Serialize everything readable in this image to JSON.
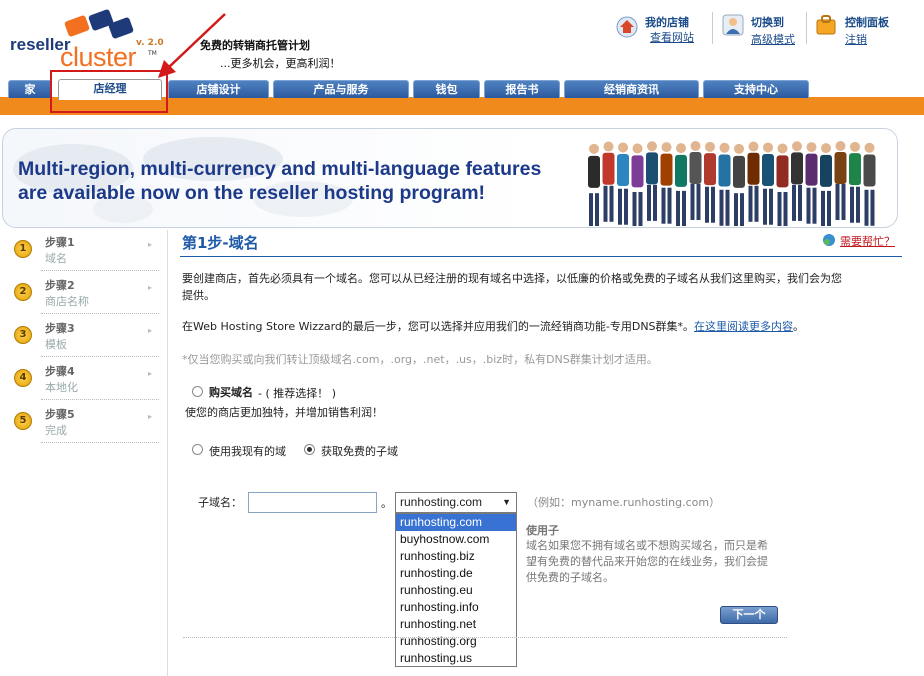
{
  "logo": {
    "reseller": "reseller",
    "cluster": "cluster",
    "version": "v. 2.0",
    "tm": "TM"
  },
  "tagline": {
    "line1": "免费的转销商托管计划",
    "line2": "...更多机会，更高利润！"
  },
  "top_links": {
    "store": {
      "title": "我的店铺",
      "link": "查看网站"
    },
    "switch": {
      "title": "切换到",
      "link": "高级模式"
    },
    "panel": {
      "title": "控制面板",
      "link": "注销"
    }
  },
  "nav": {
    "tabs": [
      {
        "label": "家"
      },
      {
        "label": "店经理"
      },
      {
        "label": "店铺设计"
      },
      {
        "label": "产品与服务"
      },
      {
        "label": "钱包"
      },
      {
        "label": "报告书"
      },
      {
        "label": "经销商资讯"
      },
      {
        "label": "支持中心"
      }
    ]
  },
  "banner": {
    "line1": "Multi-region, multi-currency and multi-language features",
    "line2": "are available now on the reseller hosting program!"
  },
  "steps": [
    {
      "num": "1",
      "title": "步骤1",
      "sub": "域名"
    },
    {
      "num": "2",
      "title": "步骤2",
      "sub": "商店名称"
    },
    {
      "num": "3",
      "title": "步骤3",
      "sub": "模板"
    },
    {
      "num": "4",
      "title": "步骤4",
      "sub": "本地化"
    },
    {
      "num": "5",
      "title": "步骤5",
      "sub": "完成"
    }
  ],
  "main": {
    "heading": "第1步-域名",
    "help": "需要帮忙？",
    "para1_line1": "要创建商店，首先必须具有一个域名。您可以从已经注册的现有域名中选择，以低廉的价格或免费的子域名从我们这里购买，我们会为您",
    "para1_line2": "提供。",
    "para2_text": "在Web Hosting Store Wizzard的最后一步，您可以选择并应用我们的一流经销商功能-专用DNS群集*。",
    "para2_link": "在这里阅读更多内容",
    "para2_end": "。",
    "note": "*仅当您购买或向我们转让顶级域名.com，.org，.net，.us，.biz时，私有DNS群集计划才适用。",
    "opt_buy": "购买域名",
    "opt_buy_rec": " - ( 推荐选择！ )",
    "opt_buy_desc": "使您的商店更加独特，并增加销售利润！",
    "opt_existing": "使用我现有的域",
    "opt_free": "获取免费的子域",
    "subdomain_label": "子域名：",
    "subdomain_value": "",
    "dot": "。",
    "select_value": "runhosting.com",
    "options": [
      "runhosting.com",
      "buyhostnow.com",
      "runhosting.biz",
      "runhosting.de",
      "runhosting.eu",
      "runhosting.info",
      "runhosting.net",
      "runhosting.org",
      "runhosting.us"
    ],
    "example": "（例如：myname.runhosting.com）",
    "hint_title": "使用子",
    "hint_text": "域名如果您不拥有域名或不想购买域名，而只是希望有免费的替代品来开始您的在线业务，我们会提供免费的子域名。",
    "next": "下一个"
  }
}
